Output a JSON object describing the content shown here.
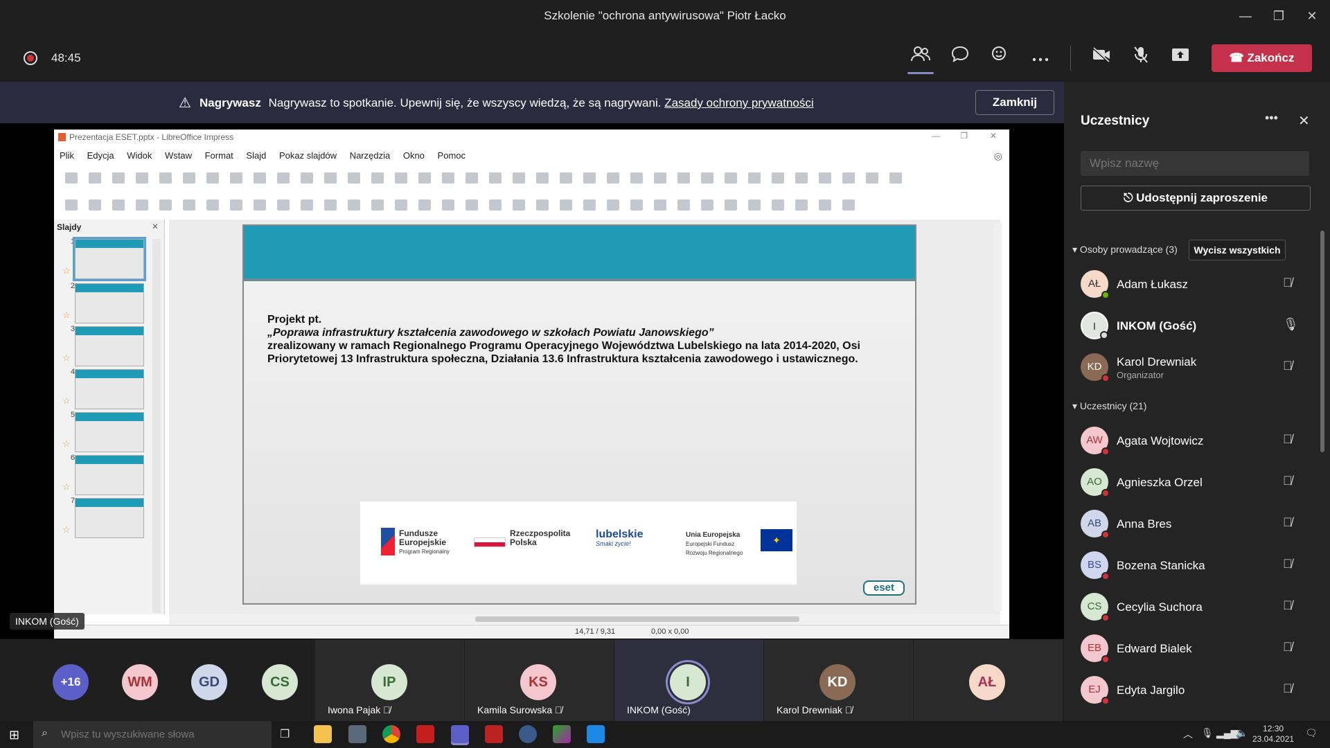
{
  "window": {
    "title": "Szkolenie \"ochrona antywirusowa\" Piotr Łacko",
    "minimize": "—",
    "restore": "❐",
    "close": "✕"
  },
  "meeting": {
    "timer": "48:45",
    "end_label": "Zakończ",
    "colors": {
      "end": "#c4314b",
      "accent": "#8b8cc7"
    }
  },
  "banner": {
    "icon": "⚠",
    "bold": "Nagrywasz",
    "text": "Nagrywasz to spotkanie. Upewnij się, że wszyscy wiedzą, że są nagrywani.",
    "link": "Zasady ochrony prywatności",
    "close_label": "Zamknij"
  },
  "lo": {
    "title": "Prezentacja ESET.pptx - LibreOffice Impress",
    "menu": [
      "Plik",
      "Edycja",
      "Widok",
      "Wstaw",
      "Format",
      "Slajd",
      "Pokaz slajdów",
      "Narzędzia",
      "Okno",
      "Pomoc"
    ],
    "slides_head": "Slajdy",
    "thumb_numbers": [
      "1",
      "2",
      "3",
      "4",
      "5",
      "6",
      "7"
    ],
    "status_pos": "14,71 / 9,31",
    "status_size": "0,00 x 0,00"
  },
  "slide": {
    "line1": "Projekt pt.",
    "line2": "„Poprawa infrastruktury kształcenia zawodowego w szkołach Powiatu Janowskiego”",
    "line3": "zrealizowany w ramach Regionalnego Programu Operacyjnego Województwa Lubelskiego na lata 2014-2020, Osi Priorytetowej 13 Infrastruktura społeczna, Działania 13.6 Infrastruktura kształcenia zawodowego i ustawicznego.",
    "logo1_a": "Fundusze",
    "logo1_b": "Europejskie",
    "logo1_c": "Program Regionalny",
    "logo2_a": "Rzeczpospolita",
    "logo2_b": "Polska",
    "logo3": "lubelskie",
    "logo3_sub": "Smaki życie!",
    "logo4_a": "Unia Europejska",
    "logo4_b": "Europejski Fundusz",
    "logo4_c": "Rozwoju Regionalnego",
    "eset": "eset"
  },
  "stage_tag": "INKOM (Gość)",
  "panel": {
    "title": "Uczestnicy",
    "search_placeholder": "Wpisz nazwę",
    "share_label": "Udostępnij zaproszenie",
    "presenters_head": "Osoby prowadzące (3)",
    "mute_all": "Wycisz wszystkich",
    "attendees_head": "Uczestnicy (21)",
    "presenters": [
      {
        "initials": "AŁ",
        "name": "Adam Łukasz",
        "sub": "",
        "color": "#f6d9c8",
        "dot": "#6bb700"
      },
      {
        "initials": "I",
        "name": "INKOM (Gość)",
        "sub": "",
        "color": "#e1e6e0",
        "dot": "#dddddd"
      },
      {
        "initials": "KD",
        "name": "Karol Drewniak",
        "sub": "Organizator",
        "color": "#8a6a55",
        "dot": "#d13438"
      }
    ],
    "attendees": [
      {
        "initials": "AW",
        "name": "Agata Wojtowicz",
        "color": "#f4c7cf"
      },
      {
        "initials": "AO",
        "name": "Agnieszka Orzel",
        "color": "#d6e8d2"
      },
      {
        "initials": "AB",
        "name": "Anna Bres",
        "color": "#cfd8ea"
      },
      {
        "initials": "BS",
        "name": "Bozena Stanicka",
        "color": "#cfd7f0"
      },
      {
        "initials": "CS",
        "name": "Cecylia Suchora",
        "color": "#d6e8d2"
      },
      {
        "initials": "EB",
        "name": "Edward Bialek",
        "color": "#f4c7cf"
      },
      {
        "initials": "EJ",
        "name": "Edyta Jargilo",
        "color": "#f4c7cf"
      }
    ]
  },
  "gallery": {
    "overflow": "+16",
    "small": [
      {
        "initials": "WM",
        "color": "#f4c7cf"
      },
      {
        "initials": "GD",
        "color": "#cfd8ea"
      },
      {
        "initials": "CS",
        "color": "#d6e8d2"
      }
    ],
    "tiles": [
      {
        "initials": "IP",
        "name": "Iwona Pajak",
        "color": "#d6e8d2"
      },
      {
        "initials": "KS",
        "name": "Kamila Surowska",
        "color": "#f4c7cf"
      },
      {
        "initials": "I",
        "name": "INKOM (Gość)",
        "color": "#d6e8d2"
      },
      {
        "initials": "KD",
        "name": "Karol Drewniak",
        "color": "#8a6a55"
      },
      {
        "initials": "AŁ",
        "name": "",
        "color": "#f6d9c8"
      }
    ]
  },
  "taskbar": {
    "search_placeholder": "Wpisz tu wyszukiwane słowa",
    "time": "12:30",
    "date": "23.04.2021"
  }
}
